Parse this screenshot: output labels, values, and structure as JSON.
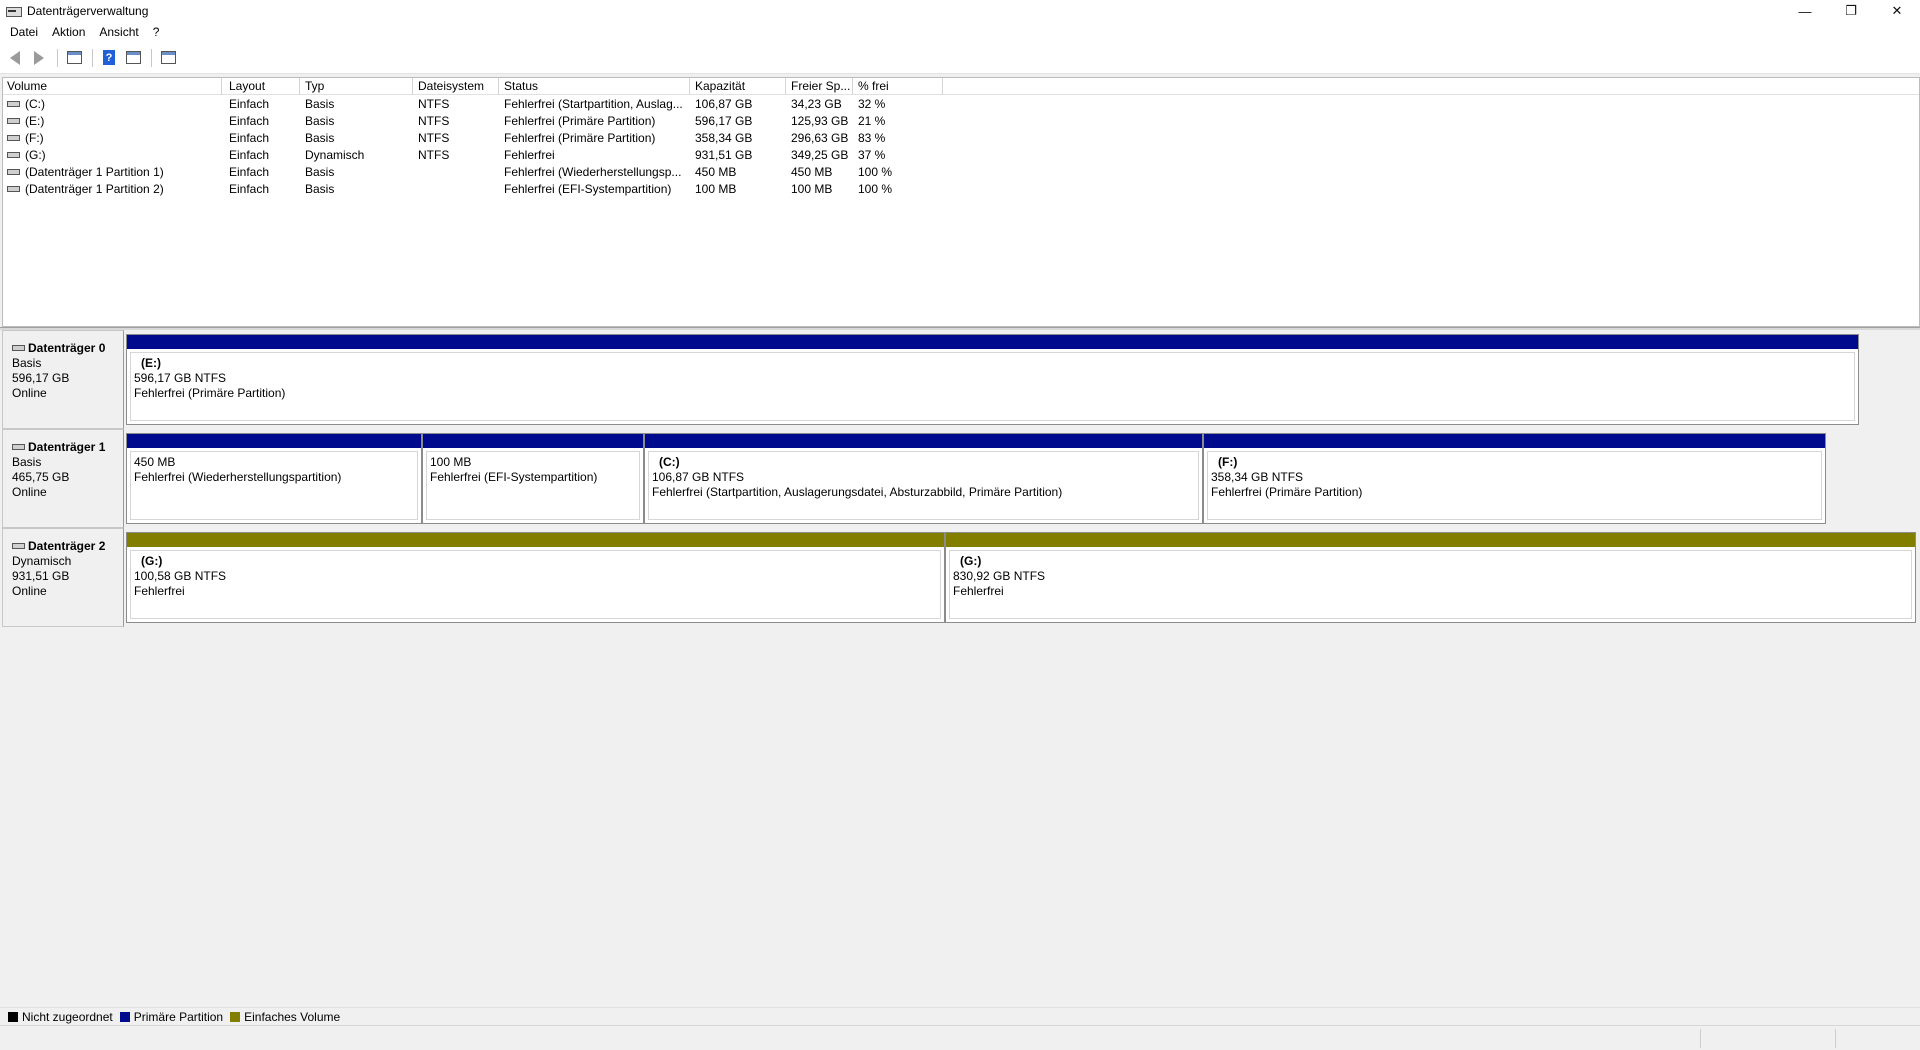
{
  "window": {
    "title": "Datenträgerverwaltung",
    "minimize_glyph": "—",
    "restore_glyph": "❐",
    "close_glyph": "✕"
  },
  "menu": [
    "Datei",
    "Aktion",
    "Ansicht",
    "?"
  ],
  "toolbar": {
    "buttons": [
      "back-icon",
      "forward-icon",
      "disk-list-icon",
      "help-icon",
      "properties-icon",
      "view-icon"
    ],
    "help_glyph": "?"
  },
  "volume_list": {
    "columns": [
      "Volume",
      "Layout",
      "Typ",
      "Dateisystem",
      "Status",
      "Kapazität",
      "Freier Sp...",
      "% frei"
    ],
    "rows": [
      [
        "(C:)",
        "Einfach",
        "Basis",
        "NTFS",
        "Fehlerfrei (Startpartition, Auslag...",
        "106,87 GB",
        "34,23 GB",
        "32 %"
      ],
      [
        "(E:)",
        "Einfach",
        "Basis",
        "NTFS",
        "Fehlerfrei (Primäre Partition)",
        "596,17 GB",
        "125,93 GB",
        "21 %"
      ],
      [
        "(F:)",
        "Einfach",
        "Basis",
        "NTFS",
        "Fehlerfrei (Primäre Partition)",
        "358,34 GB",
        "296,63 GB",
        "83 %"
      ],
      [
        "(G:)",
        "Einfach",
        "Dynamisch",
        "NTFS",
        "Fehlerfrei",
        "931,51 GB",
        "349,25 GB",
        "37 %"
      ],
      [
        "(Datenträger 1 Partition 1)",
        "Einfach",
        "Basis",
        "",
        "Fehlerfrei (Wiederherstellungsp...",
        "450 MB",
        "450 MB",
        "100 %"
      ],
      [
        "(Datenträger 1 Partition 2)",
        "Einfach",
        "Basis",
        "",
        "Fehlerfrei (EFI-Systempartition)",
        "100 MB",
        "100 MB",
        "100 %"
      ]
    ]
  },
  "disks": [
    {
      "name": "Datenträger 0",
      "type": "Basis",
      "size": "596,17 GB",
      "state": "Online",
      "partitions": [
        {
          "title": "(E:)",
          "size": "596,17 GB NTFS",
          "status": "Fehlerfrei (Primäre Partition)",
          "kind": "primary"
        }
      ]
    },
    {
      "name": "Datenträger 1",
      "type": "Basis",
      "size": "465,75 GB",
      "state": "Online",
      "partitions": [
        {
          "title": "",
          "size": "450 MB",
          "status": "Fehlerfrei (Wiederherstellungspartition)",
          "kind": "primary"
        },
        {
          "title": "",
          "size": "100 MB",
          "status": "Fehlerfrei (EFI-Systempartition)",
          "kind": "primary"
        },
        {
          "title": "(C:)",
          "size": "106,87 GB NTFS",
          "status": "Fehlerfrei (Startpartition, Auslagerungsdatei, Absturzabbild, Primäre Partition)",
          "kind": "primary"
        },
        {
          "title": "(F:)",
          "size": "358,34 GB NTFS",
          "status": "Fehlerfrei (Primäre Partition)",
          "kind": "primary"
        }
      ]
    },
    {
      "name": "Datenträger 2",
      "type": "Dynamisch",
      "size": "931,51 GB",
      "state": "Online",
      "partitions": [
        {
          "title": "(G:)",
          "size": "100,58 GB NTFS",
          "status": "Fehlerfrei",
          "kind": "simple"
        },
        {
          "title": "(G:)",
          "size": "830,92 GB NTFS",
          "status": "Fehlerfrei",
          "kind": "simple"
        }
      ]
    }
  ],
  "legend": [
    {
      "label": "Nicht zugeordnet",
      "color": "#000000"
    },
    {
      "label": "Primäre Partition",
      "color": "#000a8c"
    },
    {
      "label": "Einfaches Volume",
      "color": "#827f00"
    }
  ],
  "colors": {
    "primary_bar": "#000a8c",
    "simple_bar": "#827f00",
    "unallocated": "#000000"
  }
}
